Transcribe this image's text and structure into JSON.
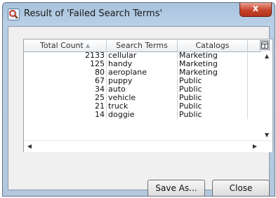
{
  "window": {
    "title": "Result of 'Failed Search Terms'",
    "close_glyph": "x"
  },
  "table": {
    "headers": {
      "count": "Total Count",
      "term": "Search Terms",
      "catalog": "Catalogs"
    },
    "sort_indicator": "▲",
    "rows": [
      {
        "count": "2133",
        "term": "cellular",
        "catalog": "Marketing"
      },
      {
        "count": "125",
        "term": "handy",
        "catalog": "Marketing"
      },
      {
        "count": "80",
        "term": "aeroplane",
        "catalog": "Marketing"
      },
      {
        "count": "67",
        "term": "puppy",
        "catalog": "Public"
      },
      {
        "count": "34",
        "term": "auto",
        "catalog": "Public"
      },
      {
        "count": "25",
        "term": "vehicle",
        "catalog": "Public"
      },
      {
        "count": "21",
        "term": "truck",
        "catalog": "Public"
      },
      {
        "count": "14",
        "term": "doggie",
        "catalog": "Public"
      }
    ]
  },
  "scroll": {
    "up": "▲",
    "down": "▼",
    "left": "◀",
    "right": "▶"
  },
  "buttons": {
    "save_as": "Save As...",
    "close": "Close"
  },
  "colors": {
    "titlebar": "#b8cfe6",
    "close_button": "#c7442b"
  }
}
